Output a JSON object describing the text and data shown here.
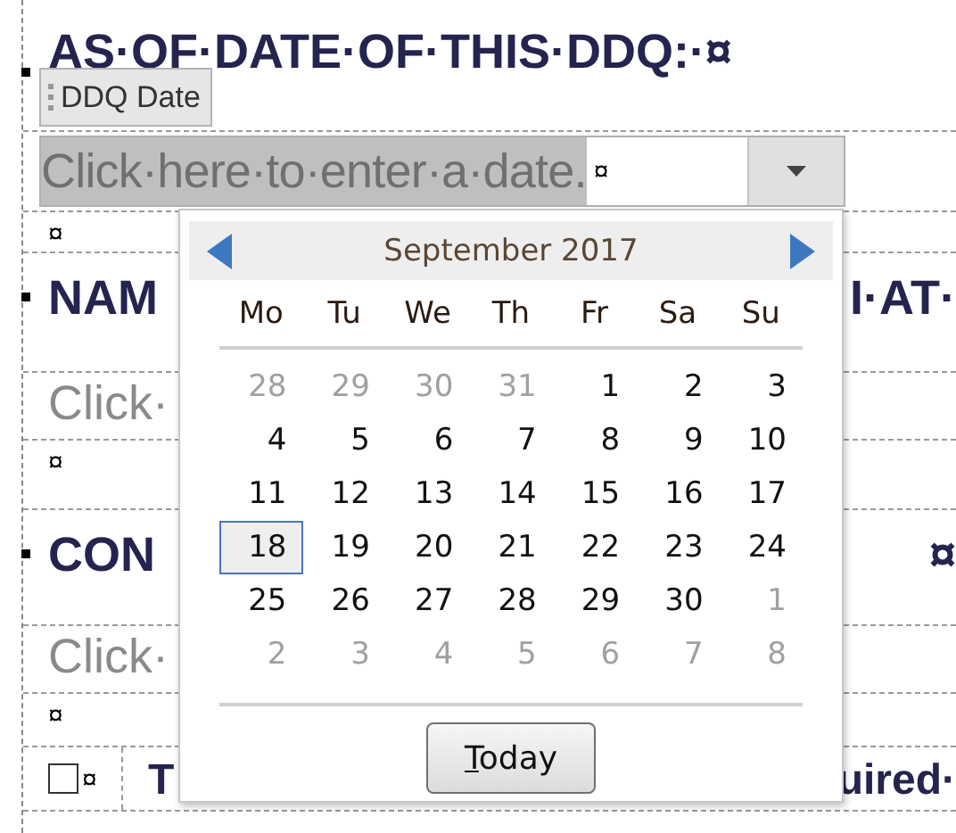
{
  "document": {
    "date_heading": "AS·OF·DATE·OF·THIS·DDQ:·¤",
    "date_control": {
      "tag": "DDQ Date",
      "prompt": "Click·here·to·enter·a·date.",
      "end_mark": "¤",
      "dropdown_open": true
    },
    "rows": [
      {
        "kind": "mark",
        "text": "¤"
      },
      {
        "kind": "heading",
        "left": "NAM",
        "right": "I·AT·"
      },
      {
        "kind": "prompt",
        "left": "Click·"
      },
      {
        "kind": "mark",
        "text": "¤"
      },
      {
        "kind": "heading",
        "left": "CON",
        "right": "¤"
      },
      {
        "kind": "prompt",
        "left": "Click·"
      },
      {
        "kind": "mark",
        "text": "¤"
      },
      {
        "kind": "checkbox",
        "checked": false,
        "mark": "¤",
        "left": "T",
        "right": "uired·"
      }
    ]
  },
  "calendar": {
    "month": "September 2017",
    "weekdays": [
      "Mo",
      "Tu",
      "We",
      "Th",
      "Fr",
      "Sa",
      "Su"
    ],
    "days": [
      {
        "label": "28",
        "other_month": true,
        "selected": false
      },
      {
        "label": "29",
        "other_month": true,
        "selected": false
      },
      {
        "label": "30",
        "other_month": true,
        "selected": false
      },
      {
        "label": "31",
        "other_month": true,
        "selected": false
      },
      {
        "label": "1",
        "other_month": false,
        "selected": false
      },
      {
        "label": "2",
        "other_month": false,
        "selected": false
      },
      {
        "label": "3",
        "other_month": false,
        "selected": false
      },
      {
        "label": "4",
        "other_month": false,
        "selected": false
      },
      {
        "label": "5",
        "other_month": false,
        "selected": false
      },
      {
        "label": "6",
        "other_month": false,
        "selected": false
      },
      {
        "label": "7",
        "other_month": false,
        "selected": false
      },
      {
        "label": "8",
        "other_month": false,
        "selected": false
      },
      {
        "label": "9",
        "other_month": false,
        "selected": false
      },
      {
        "label": "10",
        "other_month": false,
        "selected": false
      },
      {
        "label": "11",
        "other_month": false,
        "selected": false
      },
      {
        "label": "12",
        "other_month": false,
        "selected": false
      },
      {
        "label": "13",
        "other_month": false,
        "selected": false
      },
      {
        "label": "14",
        "other_month": false,
        "selected": false
      },
      {
        "label": "15",
        "other_month": false,
        "selected": false
      },
      {
        "label": "16",
        "other_month": false,
        "selected": false
      },
      {
        "label": "17",
        "other_month": false,
        "selected": false
      },
      {
        "label": "18",
        "other_month": false,
        "selected": true
      },
      {
        "label": "19",
        "other_month": false,
        "selected": false
      },
      {
        "label": "20",
        "other_month": false,
        "selected": false
      },
      {
        "label": "21",
        "other_month": false,
        "selected": false
      },
      {
        "label": "22",
        "other_month": false,
        "selected": false
      },
      {
        "label": "23",
        "other_month": false,
        "selected": false
      },
      {
        "label": "24",
        "other_month": false,
        "selected": false
      },
      {
        "label": "25",
        "other_month": false,
        "selected": false
      },
      {
        "label": "26",
        "other_month": false,
        "selected": false
      },
      {
        "label": "27",
        "other_month": false,
        "selected": false
      },
      {
        "label": "28",
        "other_month": false,
        "selected": false
      },
      {
        "label": "29",
        "other_month": false,
        "selected": false
      },
      {
        "label": "30",
        "other_month": false,
        "selected": false
      },
      {
        "label": "1",
        "other_month": true,
        "selected": false
      },
      {
        "label": "2",
        "other_month": true,
        "selected": false
      },
      {
        "label": "3",
        "other_month": true,
        "selected": false
      },
      {
        "label": "4",
        "other_month": true,
        "selected": false
      },
      {
        "label": "5",
        "other_month": true,
        "selected": false
      },
      {
        "label": "6",
        "other_month": true,
        "selected": false
      },
      {
        "label": "7",
        "other_month": true,
        "selected": false
      },
      {
        "label": "8",
        "other_month": true,
        "selected": false
      }
    ],
    "today_button": "Today"
  }
}
